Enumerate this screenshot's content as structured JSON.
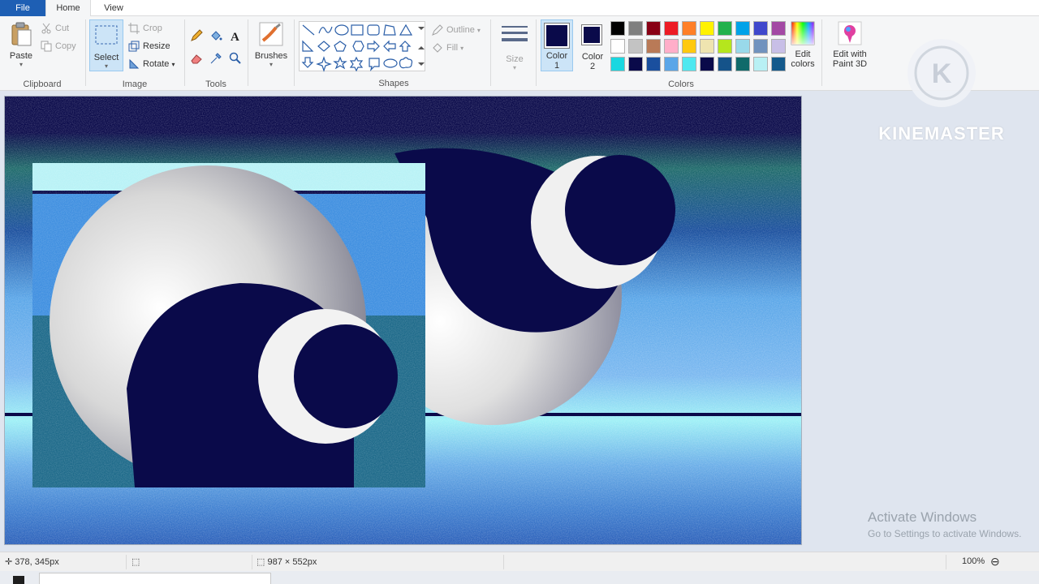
{
  "tabs": {
    "file": "File",
    "home": "Home",
    "view": "View"
  },
  "clipboard": {
    "paste": "Paste",
    "cut": "Cut",
    "copy": "Copy",
    "label": "Clipboard"
  },
  "image": {
    "select": "Select",
    "crop": "Crop",
    "resize": "Resize",
    "rotate": "Rotate",
    "label": "Image"
  },
  "tools": {
    "label": "Tools"
  },
  "brushes": {
    "label": "Brushes"
  },
  "shapes": {
    "outline": "Outline",
    "fill": "Fill",
    "label": "Shapes"
  },
  "size": {
    "label": "Size"
  },
  "colors": {
    "color1_label": "Color",
    "color1_num": "1",
    "color2_label": "Color",
    "color2_num": "2",
    "edit_colors": "Edit colors",
    "edit_paint3d": "Edit with Paint 3D",
    "label": "Colors",
    "color1_value": "#0a0a4a",
    "color2_value": "#0a0a4a",
    "palette_row1": [
      "#000000",
      "#7f7f7f",
      "#880015",
      "#ed1c24",
      "#ff7f27",
      "#fff200",
      "#22b14c",
      "#00a2e8",
      "#3f48cc",
      "#a349a4"
    ],
    "palette_row2": [
      "#ffffff",
      "#c3c3c3",
      "#b97a57",
      "#ffaec9",
      "#ffc90e",
      "#efe4b0",
      "#b5e61d",
      "#99d9ea",
      "#7092be",
      "#c8bfe7"
    ],
    "palette_row3": [
      "#19d7e0",
      "#0a0a4a",
      "#1a4f9e",
      "#5aa6e8",
      "#4ee8f0",
      "#0a0a4a",
      "#15538a",
      "#106a6a",
      "#b8f0f4",
      "#145a8c"
    ]
  },
  "watermark": {
    "brand": "KINEMASTER",
    "activate_title": "Activate Windows",
    "activate_sub": "Go to Settings to activate Windows."
  },
  "status": {
    "cursor": "378, 345px",
    "canvas_size": "987 × 552px",
    "zoom": "100%"
  }
}
